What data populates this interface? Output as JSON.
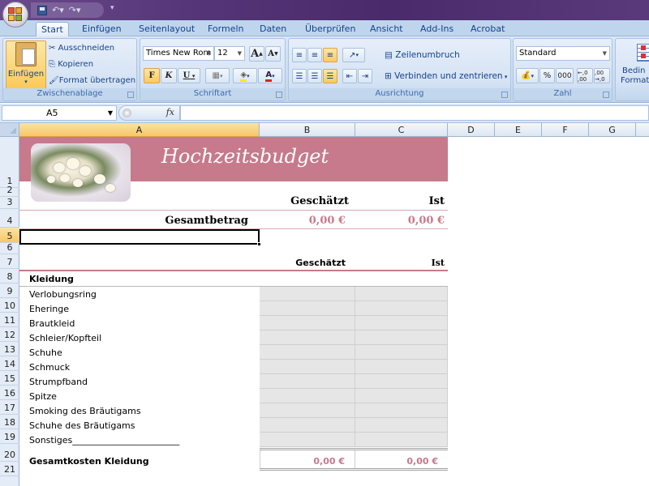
{
  "app": {
    "qat": {
      "save": "save-icon",
      "undo": "undo-icon",
      "redo": "redo-icon",
      "customize": "customize-qat-icon"
    }
  },
  "tabs": [
    "Start",
    "Einfügen",
    "Seitenlayout",
    "Formeln",
    "Daten",
    "Überprüfen",
    "Ansicht",
    "Add-Ins",
    "Acrobat"
  ],
  "active_tab": "Start",
  "ribbon": {
    "clipboard": {
      "label": "Zwischenablage",
      "paste": "Einfügen",
      "cut": "Ausschneiden",
      "copy": "Kopieren",
      "format_painter": "Format übertragen"
    },
    "font": {
      "label": "Schriftart",
      "font_name": "Times New Rom",
      "font_size": "12",
      "bold": "F",
      "italic": "K",
      "underline": "U"
    },
    "alignment": {
      "label": "Ausrichtung",
      "wrap": "Zeilenumbruch",
      "merge": "Verbinden und zentrieren"
    },
    "number": {
      "label": "Zahl",
      "format": "Standard",
      "percent": "%",
      "thousands": "000",
      "inc_decimal": "←,0 ,00",
      "dec_decimal": ",00 →,0"
    },
    "styles": {
      "cond_format_line1": "Bedin",
      "cond_format_line2": "Formati"
    }
  },
  "formula_bar": {
    "name_box": "A5",
    "fx": "fx",
    "value": ""
  },
  "columns": [
    "A",
    "B",
    "C",
    "D",
    "E",
    "F",
    "G"
  ],
  "selected_column": "A",
  "rows": [
    "1",
    "2",
    "3",
    "4",
    "5",
    "6",
    "7",
    "8",
    "9",
    "10",
    "11",
    "12",
    "13",
    "14",
    "15",
    "16",
    "17",
    "18",
    "19",
    "20",
    "21"
  ],
  "selected_row": "5",
  "sheet": {
    "title": "Hochzeitsbudget",
    "header_estimated": "Geschätzt",
    "header_actual": "Ist",
    "total_label": "Gesamtbetrag",
    "total_estimated": "0,00 €",
    "total_actual": "0,00 €",
    "section": {
      "name": "Kleidung",
      "header_estimated": "Geschätzt",
      "header_actual": "Ist",
      "items": [
        "Verlobungsring",
        "Eheringe",
        "Brautkleid",
        "Schleier/Kopfteil",
        "Schuhe",
        "Schmuck",
        "Strumpfband",
        "Spitze",
        "Smoking des Bräutigams",
        "Schuhe des Bräutigams",
        "Sonstiges________________________"
      ],
      "subtotal_label": "Gesamtkosten Kleidung",
      "subtotal_estimated": "0,00 €",
      "subtotal_actual": "0,00 €"
    }
  },
  "colors": {
    "accent": "#c67a8b",
    "input_cell": "#e6e6e6",
    "selection": "#f7c66a"
  }
}
